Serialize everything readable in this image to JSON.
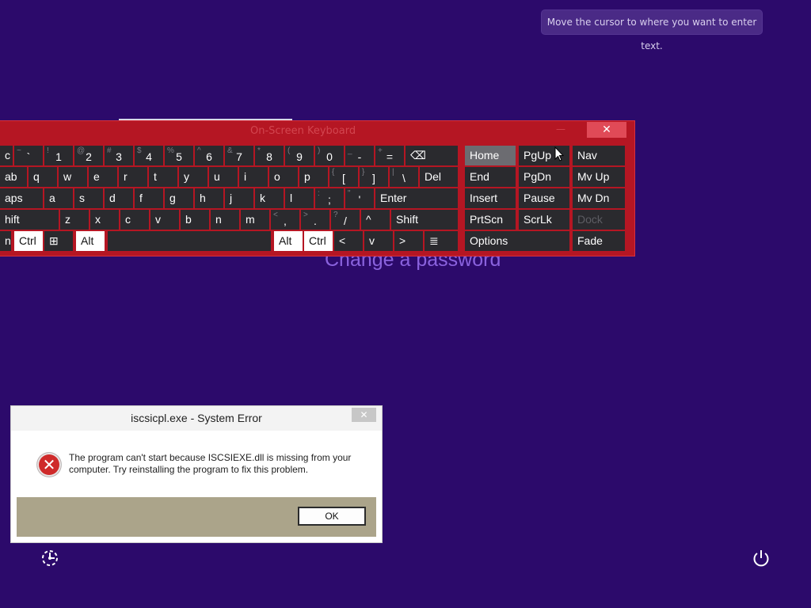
{
  "tooltip": "Move the cursor to where you want to enter text.",
  "background_heading": "Change a password",
  "keyboard": {
    "title": "On-Screen Keyboard",
    "close_glyph": "✕",
    "minimize_glyph": "—",
    "keys": [
      {
        "sub": "",
        "main": "c"
      },
      {
        "sub": "~",
        "main": "`"
      },
      {
        "sub": "!",
        "main": "1"
      },
      {
        "sub": "@",
        "main": "2"
      },
      {
        "sub": "#",
        "main": "3"
      },
      {
        "sub": "$",
        "main": "4"
      },
      {
        "sub": "%",
        "main": "5"
      },
      {
        "sub": "^",
        "main": "6"
      },
      {
        "sub": "&",
        "main": "7"
      },
      {
        "sub": "*",
        "main": "8"
      },
      {
        "sub": "(",
        "main": "9"
      },
      {
        "sub": ")",
        "main": "0"
      },
      {
        "sub": "_",
        "main": "-"
      },
      {
        "sub": "+",
        "main": "="
      },
      {
        "sub": "",
        "main": "⌫"
      }
    ],
    "row2": [
      "ab",
      "q",
      "w",
      "e",
      "r",
      "t",
      "y",
      "u",
      "i",
      "o",
      "p",
      "[",
      "]",
      "\\",
      "Del"
    ],
    "row2_sub": [
      "",
      "",
      "",
      "",
      "",
      "",
      "",
      "",
      "",
      "",
      "",
      "{",
      "}",
      "|",
      ""
    ],
    "row3": [
      "aps",
      "a",
      "s",
      "d",
      "f",
      "g",
      "h",
      "j",
      "k",
      "l",
      ";",
      "'",
      "Enter"
    ],
    "row3_sub": [
      "",
      "",
      "",
      "",
      "",
      "",
      "",
      "",
      "",
      "",
      ":",
      "\"",
      ""
    ],
    "row4": [
      "hift",
      "z",
      "x",
      "c",
      "v",
      "b",
      "n",
      "m",
      ",",
      ".",
      "/",
      "^",
      "Shift"
    ],
    "row4_sub": [
      "",
      "",
      "",
      "",
      "",
      "",
      "",
      "",
      "<",
      ">",
      "?",
      "",
      ""
    ],
    "row5": [
      "n",
      "Ctrl",
      "⊞",
      "Alt",
      "",
      "Alt",
      "Ctrl",
      "<",
      "v",
      ">",
      "≣"
    ],
    "nav": {
      "home": "Home",
      "pgup": "PgUp",
      "nav": "Nav",
      "end": "End",
      "pgdn": "PgDn",
      "mvup": "Mv Up",
      "insert": "Insert",
      "pause": "Pause",
      "mvdn": "Mv Dn",
      "prtscn": "PrtScn",
      "scrlk": "ScrLk",
      "dock": "Dock",
      "options": "Options",
      "fade": "Fade"
    }
  },
  "dialog": {
    "title": "iscsicpl.exe - System Error",
    "close_glyph": "✕",
    "icon_glyph": "✕",
    "message_line1": "The program can't start because ISCSIEXE.dll is missing from your",
    "message_line2": "computer. Try reinstalling the program to fix this problem.",
    "ok": "OK"
  },
  "colors": {
    "background": "#2c0a6b",
    "keyboard_frame": "#b51623",
    "key": "#2a2a2e",
    "dialog_footer": "#aba48a"
  },
  "icons": [
    "ease-of-access-icon",
    "power-icon",
    "error-icon",
    "windows-icon",
    "backspace-icon",
    "menu-icon"
  ]
}
